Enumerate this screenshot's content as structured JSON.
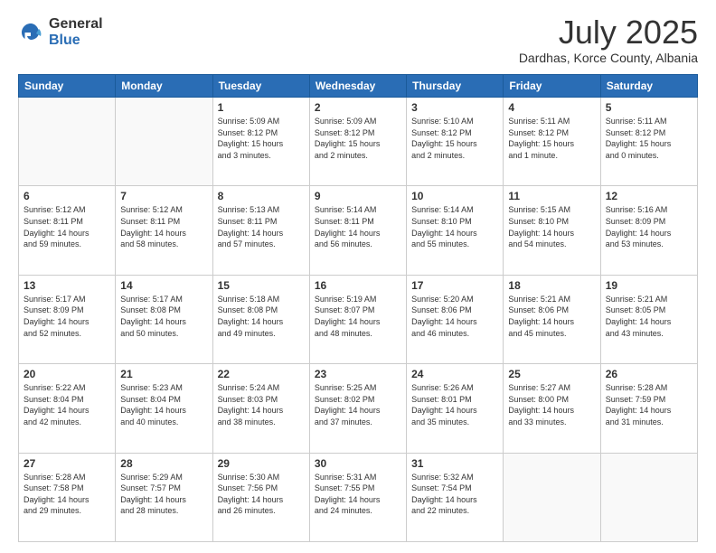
{
  "logo": {
    "general": "General",
    "blue": "Blue"
  },
  "title": "July 2025",
  "subtitle": "Dardhas, Korce County, Albania",
  "days_of_week": [
    "Sunday",
    "Monday",
    "Tuesday",
    "Wednesday",
    "Thursday",
    "Friday",
    "Saturday"
  ],
  "weeks": [
    [
      {
        "day": "",
        "info": ""
      },
      {
        "day": "",
        "info": ""
      },
      {
        "day": "1",
        "info": "Sunrise: 5:09 AM\nSunset: 8:12 PM\nDaylight: 15 hours\nand 3 minutes."
      },
      {
        "day": "2",
        "info": "Sunrise: 5:09 AM\nSunset: 8:12 PM\nDaylight: 15 hours\nand 2 minutes."
      },
      {
        "day": "3",
        "info": "Sunrise: 5:10 AM\nSunset: 8:12 PM\nDaylight: 15 hours\nand 2 minutes."
      },
      {
        "day": "4",
        "info": "Sunrise: 5:11 AM\nSunset: 8:12 PM\nDaylight: 15 hours\nand 1 minute."
      },
      {
        "day": "5",
        "info": "Sunrise: 5:11 AM\nSunset: 8:12 PM\nDaylight: 15 hours\nand 0 minutes."
      }
    ],
    [
      {
        "day": "6",
        "info": "Sunrise: 5:12 AM\nSunset: 8:11 PM\nDaylight: 14 hours\nand 59 minutes."
      },
      {
        "day": "7",
        "info": "Sunrise: 5:12 AM\nSunset: 8:11 PM\nDaylight: 14 hours\nand 58 minutes."
      },
      {
        "day": "8",
        "info": "Sunrise: 5:13 AM\nSunset: 8:11 PM\nDaylight: 14 hours\nand 57 minutes."
      },
      {
        "day": "9",
        "info": "Sunrise: 5:14 AM\nSunset: 8:11 PM\nDaylight: 14 hours\nand 56 minutes."
      },
      {
        "day": "10",
        "info": "Sunrise: 5:14 AM\nSunset: 8:10 PM\nDaylight: 14 hours\nand 55 minutes."
      },
      {
        "day": "11",
        "info": "Sunrise: 5:15 AM\nSunset: 8:10 PM\nDaylight: 14 hours\nand 54 minutes."
      },
      {
        "day": "12",
        "info": "Sunrise: 5:16 AM\nSunset: 8:09 PM\nDaylight: 14 hours\nand 53 minutes."
      }
    ],
    [
      {
        "day": "13",
        "info": "Sunrise: 5:17 AM\nSunset: 8:09 PM\nDaylight: 14 hours\nand 52 minutes."
      },
      {
        "day": "14",
        "info": "Sunrise: 5:17 AM\nSunset: 8:08 PM\nDaylight: 14 hours\nand 50 minutes."
      },
      {
        "day": "15",
        "info": "Sunrise: 5:18 AM\nSunset: 8:08 PM\nDaylight: 14 hours\nand 49 minutes."
      },
      {
        "day": "16",
        "info": "Sunrise: 5:19 AM\nSunset: 8:07 PM\nDaylight: 14 hours\nand 48 minutes."
      },
      {
        "day": "17",
        "info": "Sunrise: 5:20 AM\nSunset: 8:06 PM\nDaylight: 14 hours\nand 46 minutes."
      },
      {
        "day": "18",
        "info": "Sunrise: 5:21 AM\nSunset: 8:06 PM\nDaylight: 14 hours\nand 45 minutes."
      },
      {
        "day": "19",
        "info": "Sunrise: 5:21 AM\nSunset: 8:05 PM\nDaylight: 14 hours\nand 43 minutes."
      }
    ],
    [
      {
        "day": "20",
        "info": "Sunrise: 5:22 AM\nSunset: 8:04 PM\nDaylight: 14 hours\nand 42 minutes."
      },
      {
        "day": "21",
        "info": "Sunrise: 5:23 AM\nSunset: 8:04 PM\nDaylight: 14 hours\nand 40 minutes."
      },
      {
        "day": "22",
        "info": "Sunrise: 5:24 AM\nSunset: 8:03 PM\nDaylight: 14 hours\nand 38 minutes."
      },
      {
        "day": "23",
        "info": "Sunrise: 5:25 AM\nSunset: 8:02 PM\nDaylight: 14 hours\nand 37 minutes."
      },
      {
        "day": "24",
        "info": "Sunrise: 5:26 AM\nSunset: 8:01 PM\nDaylight: 14 hours\nand 35 minutes."
      },
      {
        "day": "25",
        "info": "Sunrise: 5:27 AM\nSunset: 8:00 PM\nDaylight: 14 hours\nand 33 minutes."
      },
      {
        "day": "26",
        "info": "Sunrise: 5:28 AM\nSunset: 7:59 PM\nDaylight: 14 hours\nand 31 minutes."
      }
    ],
    [
      {
        "day": "27",
        "info": "Sunrise: 5:28 AM\nSunset: 7:58 PM\nDaylight: 14 hours\nand 29 minutes."
      },
      {
        "day": "28",
        "info": "Sunrise: 5:29 AM\nSunset: 7:57 PM\nDaylight: 14 hours\nand 28 minutes."
      },
      {
        "day": "29",
        "info": "Sunrise: 5:30 AM\nSunset: 7:56 PM\nDaylight: 14 hours\nand 26 minutes."
      },
      {
        "day": "30",
        "info": "Sunrise: 5:31 AM\nSunset: 7:55 PM\nDaylight: 14 hours\nand 24 minutes."
      },
      {
        "day": "31",
        "info": "Sunrise: 5:32 AM\nSunset: 7:54 PM\nDaylight: 14 hours\nand 22 minutes."
      },
      {
        "day": "",
        "info": ""
      },
      {
        "day": "",
        "info": ""
      }
    ]
  ]
}
